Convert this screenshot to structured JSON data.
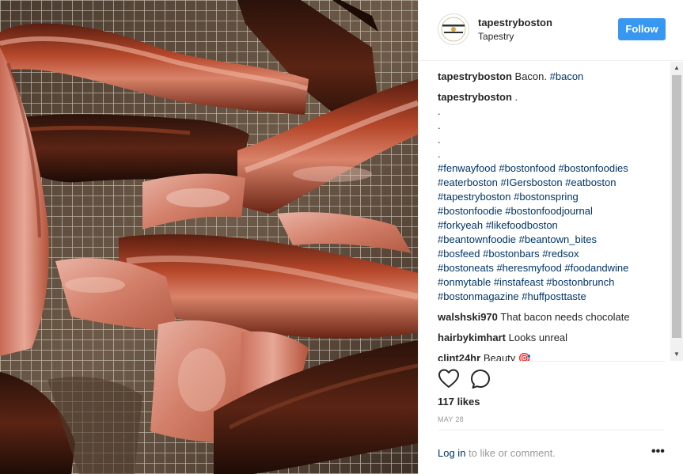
{
  "header": {
    "username": "tapestryboston",
    "location": "Tapestry",
    "follow_label": "Follow",
    "avatar_text_top": "TAPESTRY",
    "avatar_text_bottom": "BOSTON"
  },
  "caption": {
    "author": "tapestryboston",
    "text": "Bacon.",
    "hashtag": "#bacon"
  },
  "author_comment": {
    "author": "tapestryboston",
    "first_line": ".",
    "dot_lines": [
      ".",
      ".",
      ".",
      "."
    ],
    "hashtag_lines": [
      "#fenwayfood #bostonfood #bostonfoodies",
      "#eaterboston #IGersboston #eatboston",
      "#tapestryboston #bostonspring",
      "#bostonfoodie #bostonfoodjournal",
      "#forkyeah #likefoodboston",
      "#beantownfoodie #beantown_bites",
      "#bosfeed #bostonbars #redsox",
      "#bostoneats #heresmyfood #foodandwine",
      "#onmytable #instafeast #bostonbrunch",
      "#bostonmagazine #huffposttaste"
    ]
  },
  "comments": [
    {
      "author": "walshski970",
      "text": "That bacon needs chocolate"
    },
    {
      "author": "hairbykimhart",
      "text": "Looks unreal"
    },
    {
      "author": "clint24hr",
      "text": "Beauty 🎯"
    }
  ],
  "likes": "117 likes",
  "date": "MAY 28",
  "login_link": "Log in",
  "login_suffix": " to like or comment.",
  "more_glyph": "•••",
  "icons": {
    "like": "heart-icon",
    "comment": "comment-icon",
    "more": "more-options-icon"
  },
  "colors": {
    "follow": "#3897f0",
    "hashtag": "#003569",
    "text": "#262626",
    "muted": "#999999"
  }
}
